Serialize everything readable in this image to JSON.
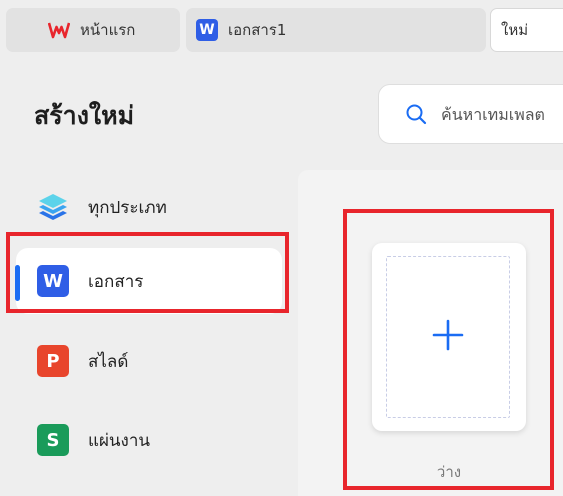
{
  "tabs": {
    "home_label": "หน้าแรก",
    "doc_label": "เอกสาร1",
    "doc_icon_letter": "W",
    "new_label": "ใหม่"
  },
  "page": {
    "title": "สร้างใหม่"
  },
  "search": {
    "placeholder": "ค้นหาเทมเพลต"
  },
  "sidebar": {
    "items": [
      {
        "label": "ทุกประเภท",
        "icon": "layers-icon"
      },
      {
        "label": "เอกสาร",
        "icon": "writer-icon",
        "letter": "W",
        "color": "#2f5ee6"
      },
      {
        "label": "สไลด์",
        "icon": "presentation-icon",
        "letter": "P",
        "color": "#e8452c"
      },
      {
        "label": "แผ่นงาน",
        "icon": "spreadsheet-icon",
        "letter": "S",
        "color": "#1a9b5a"
      }
    ]
  },
  "template": {
    "blank_label": "ว่าง"
  },
  "colors": {
    "accent": "#1a6cf3",
    "highlight": "#e8252c"
  }
}
